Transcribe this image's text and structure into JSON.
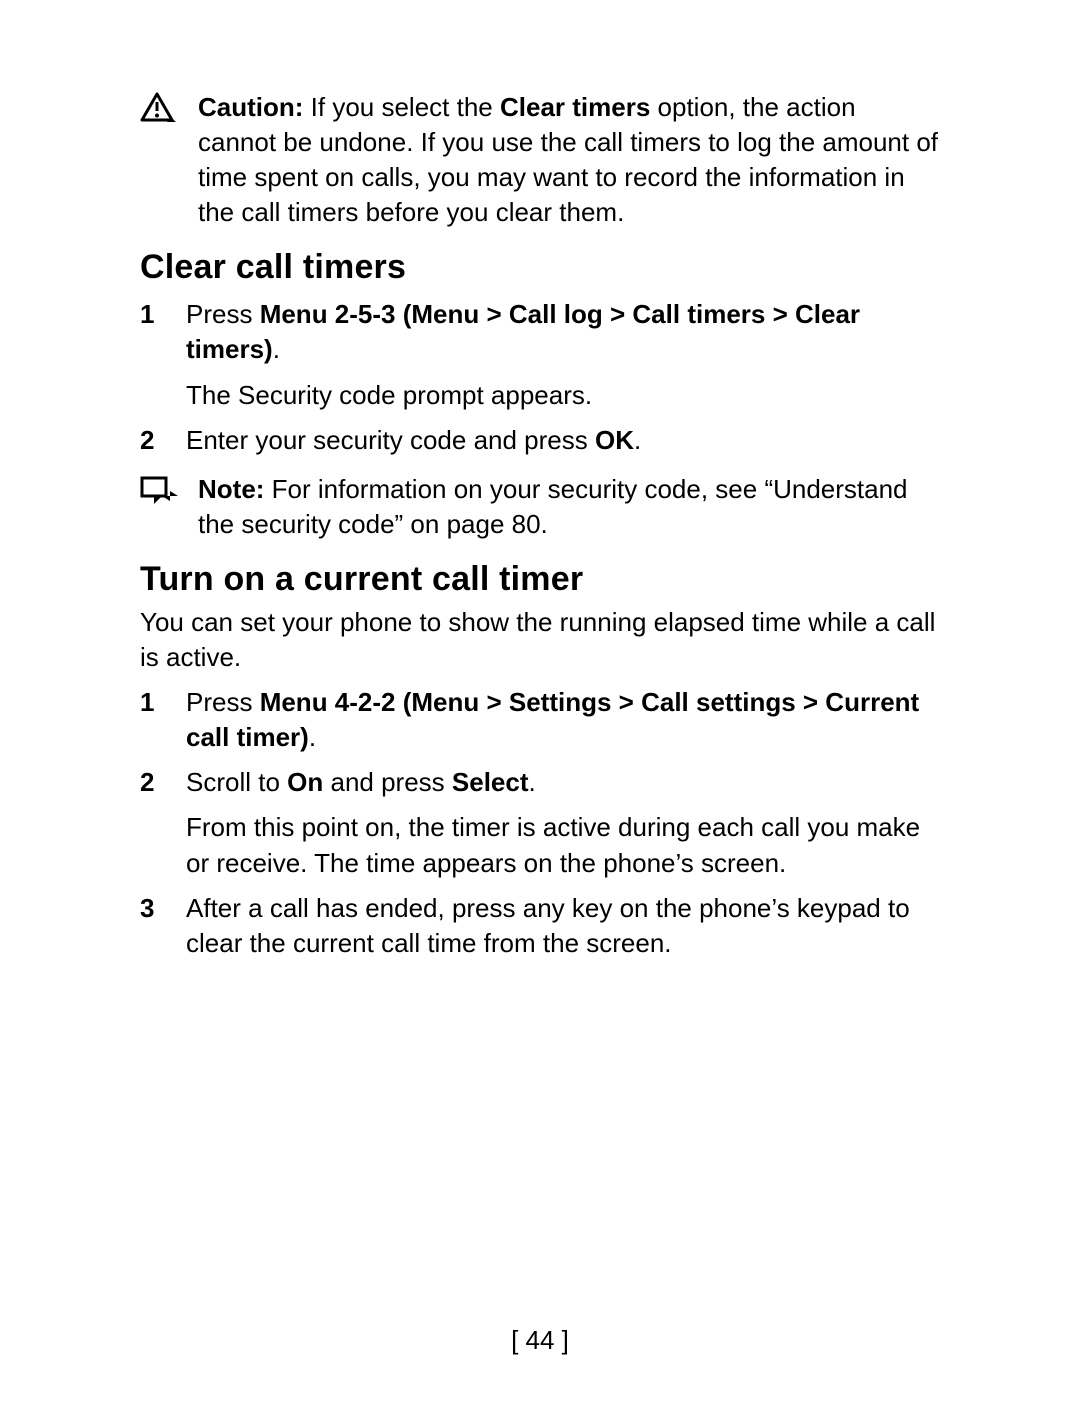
{
  "caution": {
    "label": "Caution:",
    "text_before": " If you select the ",
    "bold1": "Clear timers",
    "text_after": " option, the action cannot be undone. If you use the call timers to log the amount of time spent on calls, you may want to record the information in the call timers before you clear them."
  },
  "section1": {
    "heading": "Clear call timers",
    "steps": [
      {
        "num": "1",
        "pre": "Press ",
        "bold": "Menu 2-5-3 (Menu > Call log > Call timers > Clear timers)",
        "post": ".",
        "sub": "The Security code prompt appears."
      },
      {
        "num": "2",
        "pre": "Enter your security code and press ",
        "bold": "OK",
        "post": "."
      }
    ],
    "note": {
      "label": "Note:",
      "text": " For information on your security code, see “Understand the security code” on page 80."
    }
  },
  "section2": {
    "heading": "Turn on a current call timer",
    "intro": "You can set your phone to show the running elapsed time while a call is active.",
    "steps": [
      {
        "num": "1",
        "pre": "Press ",
        "bold": "Menu 4-2-2 (Menu > Settings > Call settings > Current call timer)",
        "post": "."
      },
      {
        "num": "2",
        "parts": [
          {
            "t": "Scroll to "
          },
          {
            "b": "On"
          },
          {
            "t": " and press "
          },
          {
            "b": "Select"
          },
          {
            "t": "."
          }
        ],
        "sub": "From this point on, the timer is active during each call you make or receive. The time appears on the phone’s screen."
      },
      {
        "num": "3",
        "pre": "After a call has ended, press any key on the phone’s keypad to clear the current call time from the screen.",
        "bold": "",
        "post": ""
      }
    ]
  },
  "page_number": "[ 44 ]"
}
